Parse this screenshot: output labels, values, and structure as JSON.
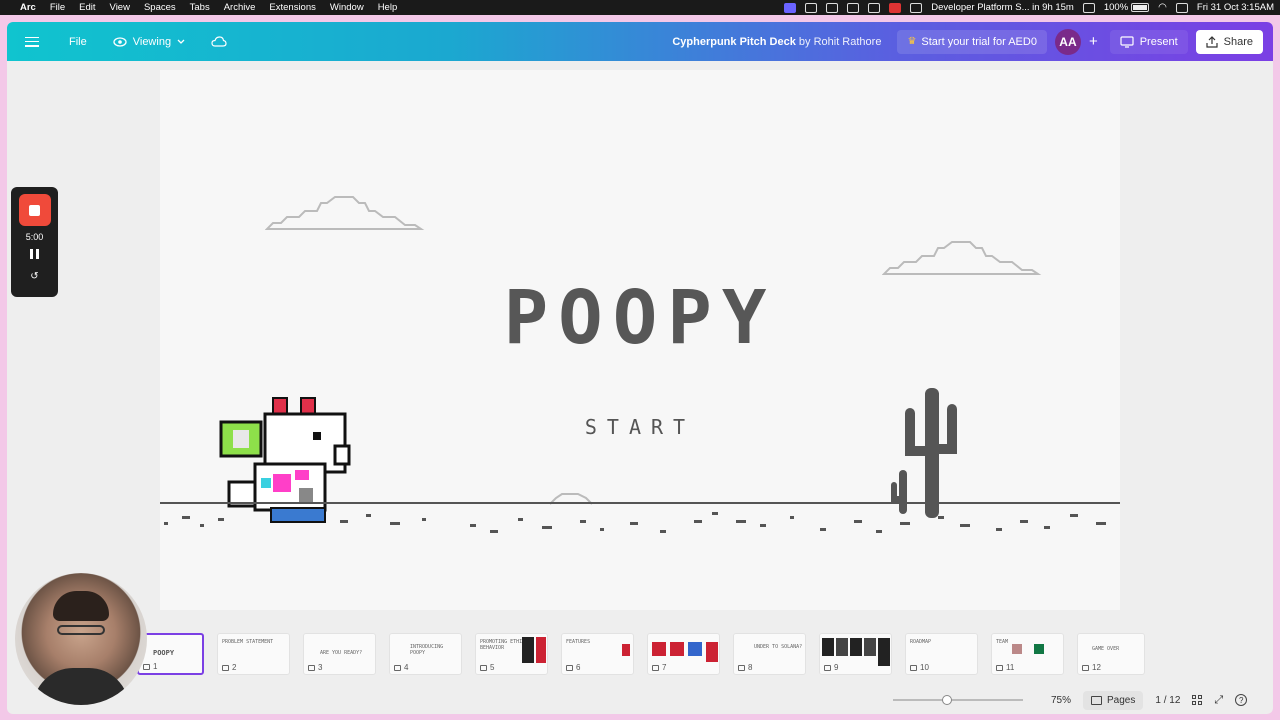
{
  "menubar": {
    "app": "Arc",
    "items": [
      "File",
      "Edit",
      "View",
      "Spaces",
      "Tabs",
      "Archive",
      "Extensions",
      "Window",
      "Help"
    ],
    "event": "Developer Platform S... in 9h 15m",
    "battery": "100%",
    "datetime": "Fri 31 Oct  3:15AM"
  },
  "toolbar": {
    "file": "File",
    "viewing": "Viewing",
    "deck_title": "Cypherpunk Pitch Deck",
    "deck_author": "by Rohit Rathore",
    "trial": "Start your trial for AED0",
    "avatar": "AA",
    "present": "Present",
    "share": "Share"
  },
  "slide": {
    "title": "POOPY",
    "start": "START"
  },
  "recorder": {
    "time": "5:00"
  },
  "thumbnails": [
    {
      "num": "1",
      "label": "POOPY"
    },
    {
      "num": "2",
      "label": "PROBLEM STATEMENT"
    },
    {
      "num": "3",
      "label": "ARE YOU READY?"
    },
    {
      "num": "4",
      "label": "INTRODUCING POOPY"
    },
    {
      "num": "5",
      "label": "PROMOTING ETHICAL BEHAVIOR"
    },
    {
      "num": "6",
      "label": "FEATURES"
    },
    {
      "num": "7",
      "label": ""
    },
    {
      "num": "8",
      "label": "UNDER TO SOLANA?"
    },
    {
      "num": "9",
      "label": ""
    },
    {
      "num": "10",
      "label": "ROADMAP"
    },
    {
      "num": "11",
      "label": "TEAM"
    },
    {
      "num": "12",
      "label": "GAME OVER"
    }
  ],
  "bottombar": {
    "zoom_level": 75,
    "zoom": "75%",
    "pages": "Pages",
    "page_count": "1 / 12"
  },
  "colors": {
    "accent": "#7b3fe4",
    "toolbar_start": "#10c4cf",
    "toolbar_end": "#7b3fe4",
    "record": "#f04a3a"
  }
}
